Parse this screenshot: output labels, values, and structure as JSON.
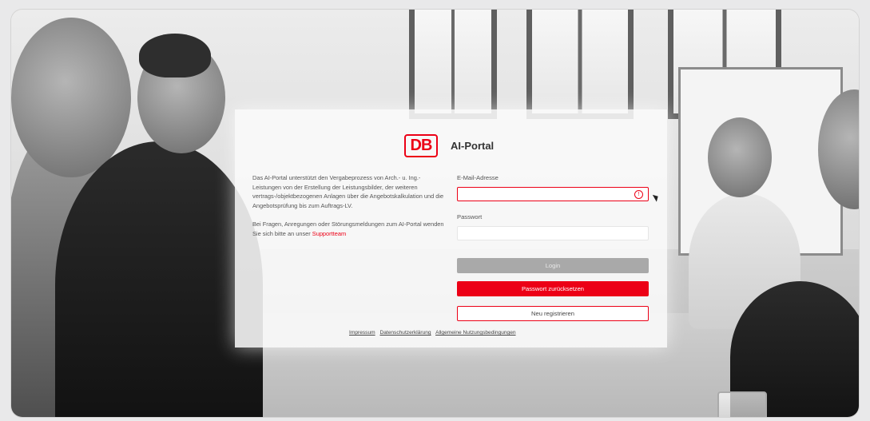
{
  "header": {
    "brand": "DB",
    "title": "AI-Portal"
  },
  "intro": {
    "paragraph1": "Das AI-Portal unterstützt den Vergabeprozess von Arch.- u. Ing.-Leistungen von der Erstellung der Leistungsbilder, der weiteren vertrags-/objektbezogenen Anlagen über die Angebotskalkulation und die Angebotsprüfung bis zum Auftrags-LV.",
    "paragraph2": "Bei Fragen, Anregungen oder Störungsmeldungen zum AI-Portal wenden Sie sich bitte an unser",
    "support_link": "Supportteam"
  },
  "form": {
    "email_label": "E-Mail-Adresse",
    "email_value": "",
    "password_label": "Passwort",
    "password_value": "",
    "login_button": "Login",
    "reset_button": "Passwort zurücksetzen",
    "register_button": "Neu registrieren"
  },
  "footer": {
    "links": [
      "Impressum",
      "Datenschutzerklärung",
      "Allgemeine Nutzungsbedingungen"
    ]
  },
  "colors": {
    "brand_red": "#ec0016",
    "disabled_gray": "#a9a9a9"
  }
}
